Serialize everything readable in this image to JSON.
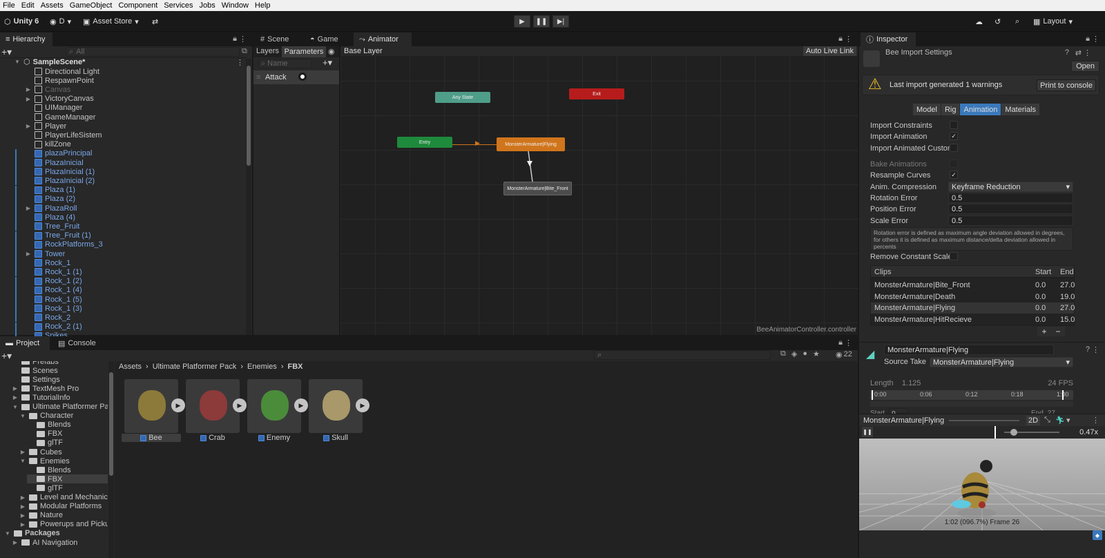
{
  "menu": [
    "File",
    "Edit",
    "Assets",
    "GameObject",
    "Component",
    "Services",
    "Jobs",
    "Window",
    "Help"
  ],
  "toolbar": {
    "unity_label": "Unity 6",
    "account_label": "D",
    "asset_store_label": "Asset Store",
    "layout_label": "Layout"
  },
  "hierarchy": {
    "tab_label": "Hierarchy",
    "search_placeholder": "All",
    "scene_name": "SampleScene*",
    "items": [
      {
        "label": "Directional Light",
        "style": "normal",
        "expand": false
      },
      {
        "label": "RespawnPoint",
        "style": "normal",
        "expand": false
      },
      {
        "label": "Canvas",
        "style": "disabled",
        "expand": true
      },
      {
        "label": "VictoryCanvas",
        "style": "normal",
        "expand": true
      },
      {
        "label": "UIManager",
        "style": "normal",
        "expand": false
      },
      {
        "label": "GameManager",
        "style": "normal",
        "expand": false
      },
      {
        "label": "Player",
        "style": "normal",
        "expand": true
      },
      {
        "label": "PlayerLifeSistem",
        "style": "normal",
        "expand": false
      },
      {
        "label": "killZone",
        "style": "normal",
        "expand": false
      },
      {
        "label": "plazaPrincipal",
        "style": "prefab",
        "expand": false
      },
      {
        "label": "PlazaInicial",
        "style": "prefab",
        "expand": false
      },
      {
        "label": "PlazaInicial (1)",
        "style": "prefab",
        "expand": false
      },
      {
        "label": "PlazaInicial (2)",
        "style": "prefab",
        "expand": false
      },
      {
        "label": "Plaza (1)",
        "style": "prefab",
        "expand": false
      },
      {
        "label": "Plaza (2)",
        "style": "prefab",
        "expand": false
      },
      {
        "label": "PlazaRoll",
        "style": "prefab",
        "expand": true
      },
      {
        "label": "Plaza (4)",
        "style": "prefab",
        "expand": false
      },
      {
        "label": "Tree_Fruit",
        "style": "prefab",
        "expand": false
      },
      {
        "label": "Tree_Fruit (1)",
        "style": "prefab",
        "expand": false
      },
      {
        "label": "RockPlatforms_3",
        "style": "prefab",
        "expand": false
      },
      {
        "label": "Tower",
        "style": "prefab",
        "expand": true
      },
      {
        "label": "Rock_1",
        "style": "prefab",
        "expand": false
      },
      {
        "label": "Rock_1 (1)",
        "style": "prefab",
        "expand": false
      },
      {
        "label": "Rock_1 (2)",
        "style": "prefab",
        "expand": false
      },
      {
        "label": "Rock_1 (4)",
        "style": "prefab",
        "expand": false
      },
      {
        "label": "Rock_1 (5)",
        "style": "prefab",
        "expand": false
      },
      {
        "label": "Rock_1 (3)",
        "style": "prefab",
        "expand": false
      },
      {
        "label": "Rock_2",
        "style": "prefab",
        "expand": false
      },
      {
        "label": "Rock_2 (1)",
        "style": "prefab",
        "expand": false
      },
      {
        "label": "Spikes",
        "style": "prefab",
        "expand": false
      }
    ]
  },
  "center_tabs": {
    "scene": "Scene",
    "game": "Game",
    "animator": "Animator"
  },
  "animator": {
    "layers_tab": "Layers",
    "parameters_tab": "Parameters",
    "name_placeholder": "Name",
    "parameter": "Attack",
    "breadcrumb": "Base Layer",
    "auto_live_link": "Auto Live Link",
    "footer": "BeeAnimatorController.controller",
    "nodes": {
      "any_state": "Any State",
      "exit": "Exit",
      "entry": "Entry",
      "flying": "MonsterArmature|Flying",
      "bite": "MonsterArmature|Bite_Front"
    }
  },
  "inspector": {
    "tab_label": "Inspector",
    "title": "Bee Import Settings",
    "open_button": "Open",
    "warning": "Last import generated 1 warnings",
    "print_button": "Print to console",
    "tabs": [
      "Model",
      "Rig",
      "Animation",
      "Materials"
    ],
    "import_constraints": "Import Constraints",
    "import_animation": "Import Animation",
    "import_animated_custom": "Import Animated Custom",
    "bake_animations": "Bake Animations",
    "resample_curves": "Resample Curves",
    "anim_compression": "Anim. Compression",
    "anim_compression_value": "Keyframe Reduction",
    "rotation_error": "Rotation Error",
    "rotation_error_value": "0.5",
    "position_error": "Position Error",
    "position_error_value": "0.5",
    "scale_error": "Scale Error",
    "scale_error_value": "0.5",
    "help_text": "Rotation error is defined as maximum angle deviation allowed in degrees, for others it is defined as maximum distance/delta deviation allowed in percents",
    "remove_constant_scale": "Remove Constant Scale",
    "clips_header": "Clips",
    "start_header": "Start",
    "end_header": "End",
    "clips": [
      {
        "name": "MonsterArmature|Bite_Front",
        "start": "0.0",
        "end": "27.0"
      },
      {
        "name": "MonsterArmature|Death",
        "start": "0.0",
        "end": "19.0"
      },
      {
        "name": "MonsterArmature|Flying",
        "start": "0.0",
        "end": "27.0"
      },
      {
        "name": "MonsterArmature|HitRecieve",
        "start": "0.0",
        "end": "15.0"
      }
    ],
    "clip_name": "MonsterArmature|Flying",
    "source_take_label": "Source Take",
    "source_take_value": "MonsterArmature|Flying",
    "length_label": "Length",
    "length_value": "1.125",
    "fps": "24 FPS",
    "timeline_ticks": [
      "0:00",
      "0:06",
      "0:12",
      "0:18",
      "1:00"
    ],
    "start_label": "Start",
    "start_value": "0",
    "end_label": "End",
    "end_value": "27",
    "preview_title": "MonsterArmature|Flying",
    "preview_speed": "0.47x",
    "preview_speed_box": "2D",
    "preview_caption": "1:02 (096.7%) Frame 26"
  },
  "project": {
    "project_tab": "Project",
    "console_tab": "Console",
    "count": "22",
    "tree": [
      {
        "label": "Prefabs",
        "indent": 1,
        "expand": false,
        "open": false
      },
      {
        "label": "Scenes",
        "indent": 1,
        "expand": false,
        "open": false
      },
      {
        "label": "Settings",
        "indent": 1,
        "expand": false,
        "open": false
      },
      {
        "label": "TextMesh Pro",
        "indent": 1,
        "expand": true,
        "open": false
      },
      {
        "label": "TutorialInfo",
        "indent": 1,
        "expand": true,
        "open": false
      },
      {
        "label": "Ultimate Platformer Pack",
        "indent": 1,
        "expand": true,
        "open": true
      },
      {
        "label": "Character",
        "indent": 2,
        "expand": true,
        "open": true
      },
      {
        "label": "Blends",
        "indent": 3,
        "expand": false,
        "open": false
      },
      {
        "label": "FBX",
        "indent": 3,
        "expand": false,
        "open": false
      },
      {
        "label": "glTF",
        "indent": 3,
        "expand": false,
        "open": false
      },
      {
        "label": "Cubes",
        "indent": 2,
        "expand": true,
        "open": false
      },
      {
        "label": "Enemies",
        "indent": 2,
        "expand": true,
        "open": true
      },
      {
        "label": "Blends",
        "indent": 3,
        "expand": false,
        "open": false
      },
      {
        "label": "FBX",
        "indent": 3,
        "expand": false,
        "open": false
      },
      {
        "label": "glTF",
        "indent": 3,
        "expand": false,
        "open": false
      },
      {
        "label": "Level and Mechanics",
        "indent": 2,
        "expand": true,
        "open": false
      },
      {
        "label": "Modular Platforms",
        "indent": 2,
        "expand": true,
        "open": false
      },
      {
        "label": "Nature",
        "indent": 2,
        "expand": true,
        "open": false
      },
      {
        "label": "Powerups and Pickups",
        "indent": 2,
        "expand": true,
        "open": false
      },
      {
        "label": "Packages",
        "indent": 0,
        "expand": true,
        "open": true
      },
      {
        "label": "AI Navigation",
        "indent": 1,
        "expand": true,
        "open": false
      }
    ],
    "breadcrumb": [
      "Assets",
      "Ultimate Platformer Pack",
      "Enemies",
      "FBX"
    ],
    "assets": [
      "Bee",
      "Crab",
      "Enemy",
      "Skull"
    ]
  },
  "colors": {
    "selection": "#2c5d87",
    "accent_blue": "#3a79bb",
    "any_state": "#4f9e8a",
    "exit": "#b71c1c",
    "entry": "#1e8a3c",
    "flying": "#d0751c",
    "state_grey": "#4c4c4c"
  }
}
